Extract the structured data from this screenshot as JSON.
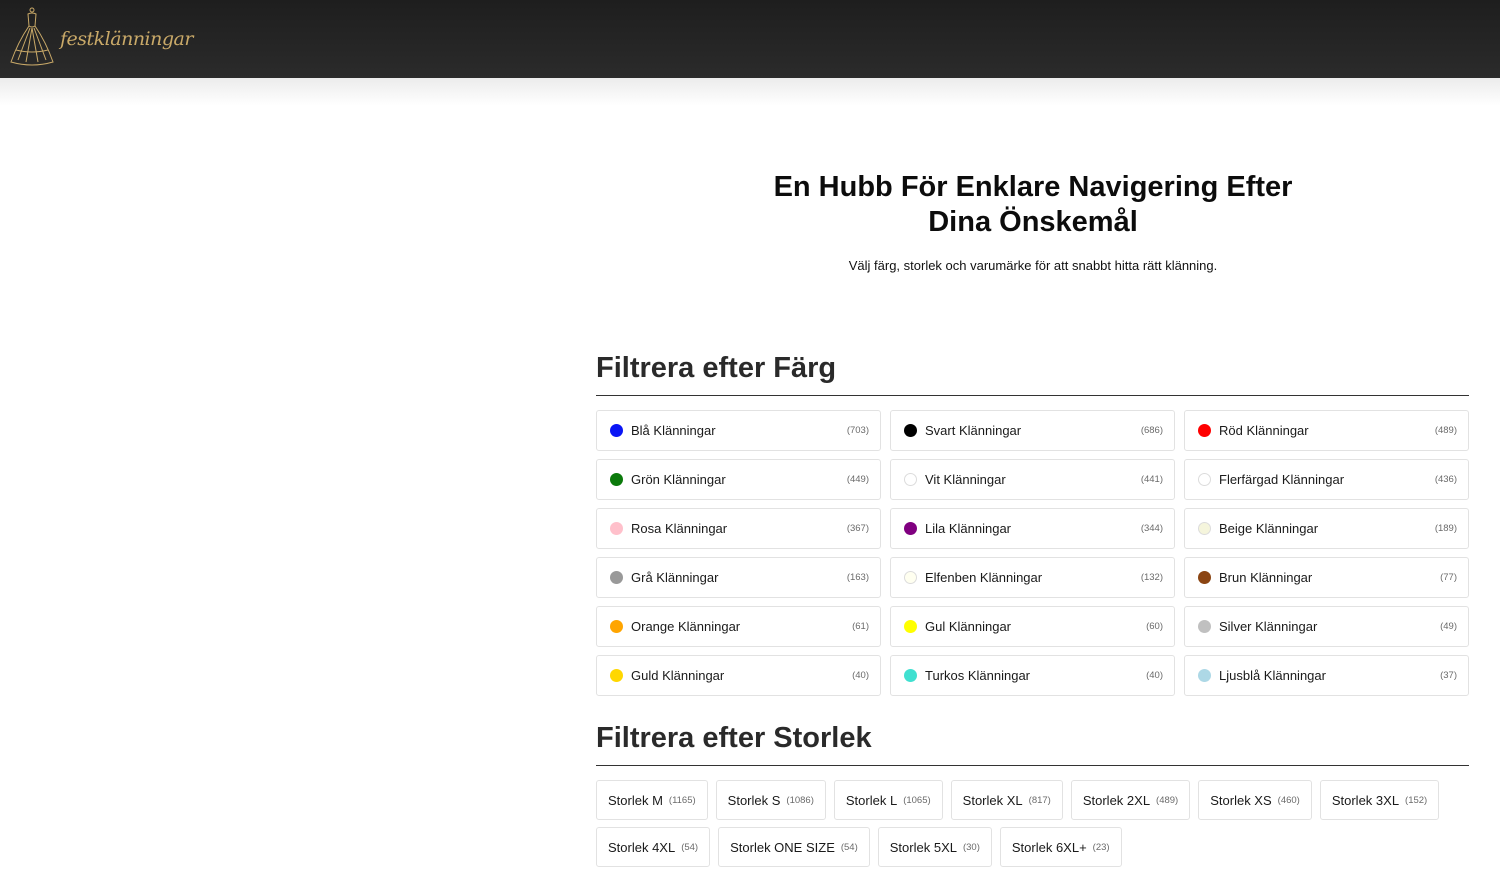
{
  "header": {
    "logo_text": "festklänningar"
  },
  "hero": {
    "title": "En Hubb För Enklare Navigering Efter Dina Önskemål",
    "subtitle": "Välj färg, storlek och varumärke för att snabbt hitta rätt klänning."
  },
  "color_section": {
    "title": "Filtrera efter Färg",
    "items": [
      {
        "label": "Blå Klänningar",
        "count": "(703)",
        "color": "#0a15f5"
      },
      {
        "label": "Svart Klänningar",
        "count": "(686)",
        "color": "#000000"
      },
      {
        "label": "Röd Klänningar",
        "count": "(489)",
        "color": "#ff0000"
      },
      {
        "label": "Grön Klänningar",
        "count": "(449)",
        "color": "#0b7a0b"
      },
      {
        "label": "Vit Klänningar",
        "count": "(441)",
        "color": "#ffffff"
      },
      {
        "label": "Flerfärgad Klänningar",
        "count": "(436)",
        "color": "#ffffff"
      },
      {
        "label": "Rosa Klänningar",
        "count": "(367)",
        "color": "#ffc0cb"
      },
      {
        "label": "Lila Klänningar",
        "count": "(344)",
        "color": "#800080"
      },
      {
        "label": "Beige Klänningar",
        "count": "(189)",
        "color": "#f5f5dc"
      },
      {
        "label": "Grå Klänningar",
        "count": "(163)",
        "color": "#999999"
      },
      {
        "label": "Elfenben Klänningar",
        "count": "(132)",
        "color": "#fffff0"
      },
      {
        "label": "Brun Klänningar",
        "count": "(77)",
        "color": "#8b4513"
      },
      {
        "label": "Orange Klänningar",
        "count": "(61)",
        "color": "#ffa500"
      },
      {
        "label": "Gul Klänningar",
        "count": "(60)",
        "color": "#ffff00"
      },
      {
        "label": "Silver Klänningar",
        "count": "(49)",
        "color": "#c0c0c0"
      },
      {
        "label": "Guld Klänningar",
        "count": "(40)",
        "color": "#ffd700"
      },
      {
        "label": "Turkos Klänningar",
        "count": "(40)",
        "color": "#40e0d0"
      },
      {
        "label": "Ljusblå Klänningar",
        "count": "(37)",
        "color": "#add8e6"
      }
    ]
  },
  "size_section": {
    "title": "Filtrera efter Storlek",
    "items": [
      {
        "label": "Storlek M",
        "count": "(1165)"
      },
      {
        "label": "Storlek S",
        "count": "(1086)"
      },
      {
        "label": "Storlek L",
        "count": "(1065)"
      },
      {
        "label": "Storlek XL",
        "count": "(817)"
      },
      {
        "label": "Storlek 2XL",
        "count": "(489)"
      },
      {
        "label": "Storlek XS",
        "count": "(460)"
      },
      {
        "label": "Storlek 3XL",
        "count": "(152)"
      },
      {
        "label": "Storlek 4XL",
        "count": "(54)"
      },
      {
        "label": "Storlek ONE SIZE",
        "count": "(54)"
      },
      {
        "label": "Storlek 5XL",
        "count": "(30)"
      },
      {
        "label": "Storlek 6XL+",
        "count": "(23)"
      }
    ]
  }
}
